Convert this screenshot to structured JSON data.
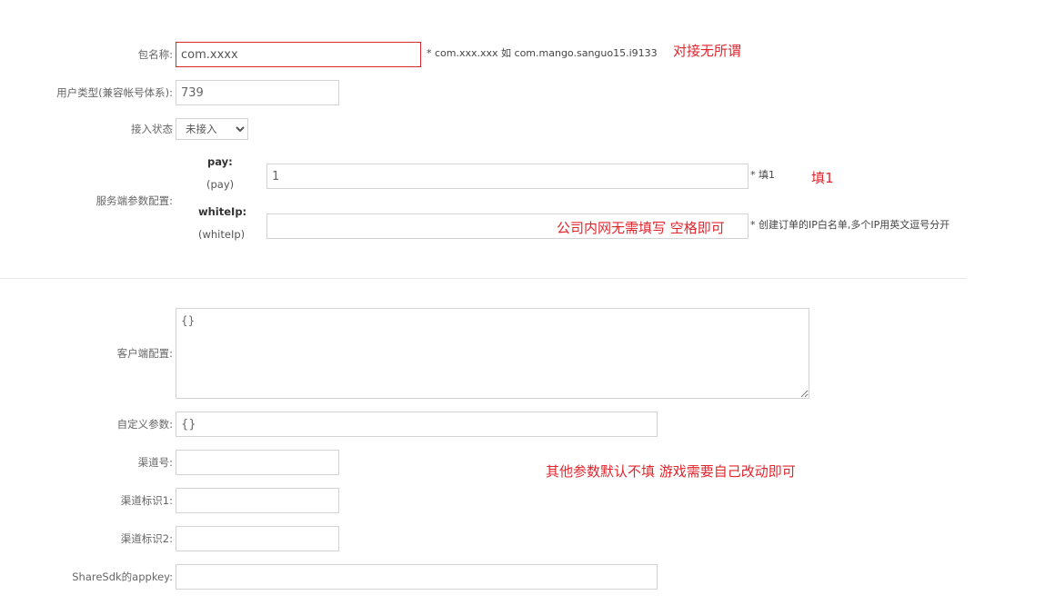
{
  "package": {
    "label": "包名称:",
    "value": "com.xxxx",
    "hint": "* com.xxx.xxx 如 com.mango.sanguo15.i9133",
    "annotation": "对接无所谓"
  },
  "user_type": {
    "label": "用户类型(兼容帐号体系):",
    "value": "739"
  },
  "access_status": {
    "label": "接入状态",
    "selected": "未接入"
  },
  "server_config": {
    "label": "服务端参数配置:",
    "pay": {
      "name": "pay:",
      "sub": "(pay)",
      "value": "1",
      "hint": "* 填1",
      "annotation": "填1"
    },
    "whiteip": {
      "name": "whiteIp:",
      "sub": "(whiteIp)",
      "value": "",
      "hint": "* 创建订单的IP白名单,多个IP用英文逗号分开",
      "annotation": "公司内网无需填写 空格即可"
    }
  },
  "client_config": {
    "label": "客户端配置:",
    "value": "{}"
  },
  "custom_params": {
    "label": "自定义参数:",
    "value": "{}"
  },
  "channel_no": {
    "label": "渠道号:",
    "value": ""
  },
  "channel_id1": {
    "label": "渠道标识1:",
    "value": ""
  },
  "channel_id2": {
    "label": "渠道标识2:",
    "value": ""
  },
  "sharesdk": {
    "label": "ShareSdk的appkey:",
    "value": ""
  },
  "other_annotation": "其他参数默认不填 游戏需要自己改动即可"
}
